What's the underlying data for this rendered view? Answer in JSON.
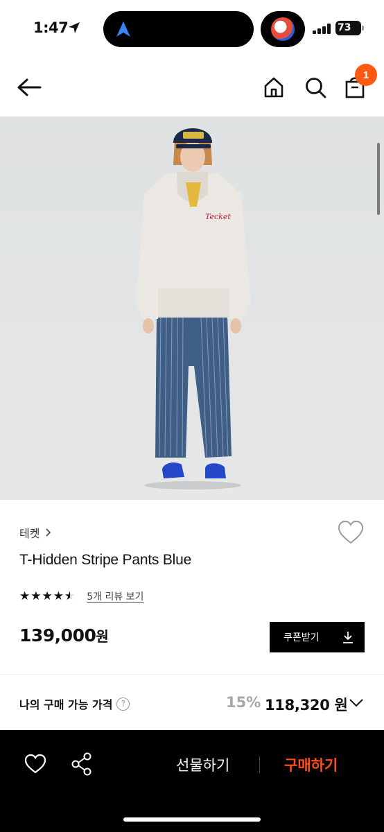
{
  "status": {
    "time": "1:47",
    "battery": "73"
  },
  "header": {
    "cart_count": "1"
  },
  "product": {
    "brand": "테켓",
    "title": "T-Hidden Stripe Pants Blue",
    "rating": 4.5,
    "stars_text": "★★★★★",
    "review_link": "5개 리뷰 보기",
    "price": "139,000",
    "price_unit": "원",
    "coupon_label": "쿠폰받기"
  },
  "my_price": {
    "label": "나의 구매 가능 가격",
    "help": "?",
    "discount": "15%",
    "final_price": "118,320 원"
  },
  "bottom_bar": {
    "gift_label": "선물하기",
    "buy_label": "구매하기"
  },
  "colors": {
    "accent": "#ff5a14",
    "buy": "#ff4f1a",
    "bar": "#000000"
  },
  "icons": [
    "back-arrow-icon",
    "home-icon",
    "search-icon",
    "shopping-bag-icon",
    "heart-icon",
    "share-icon",
    "download-icon",
    "chevron-down-icon",
    "help-icon"
  ]
}
